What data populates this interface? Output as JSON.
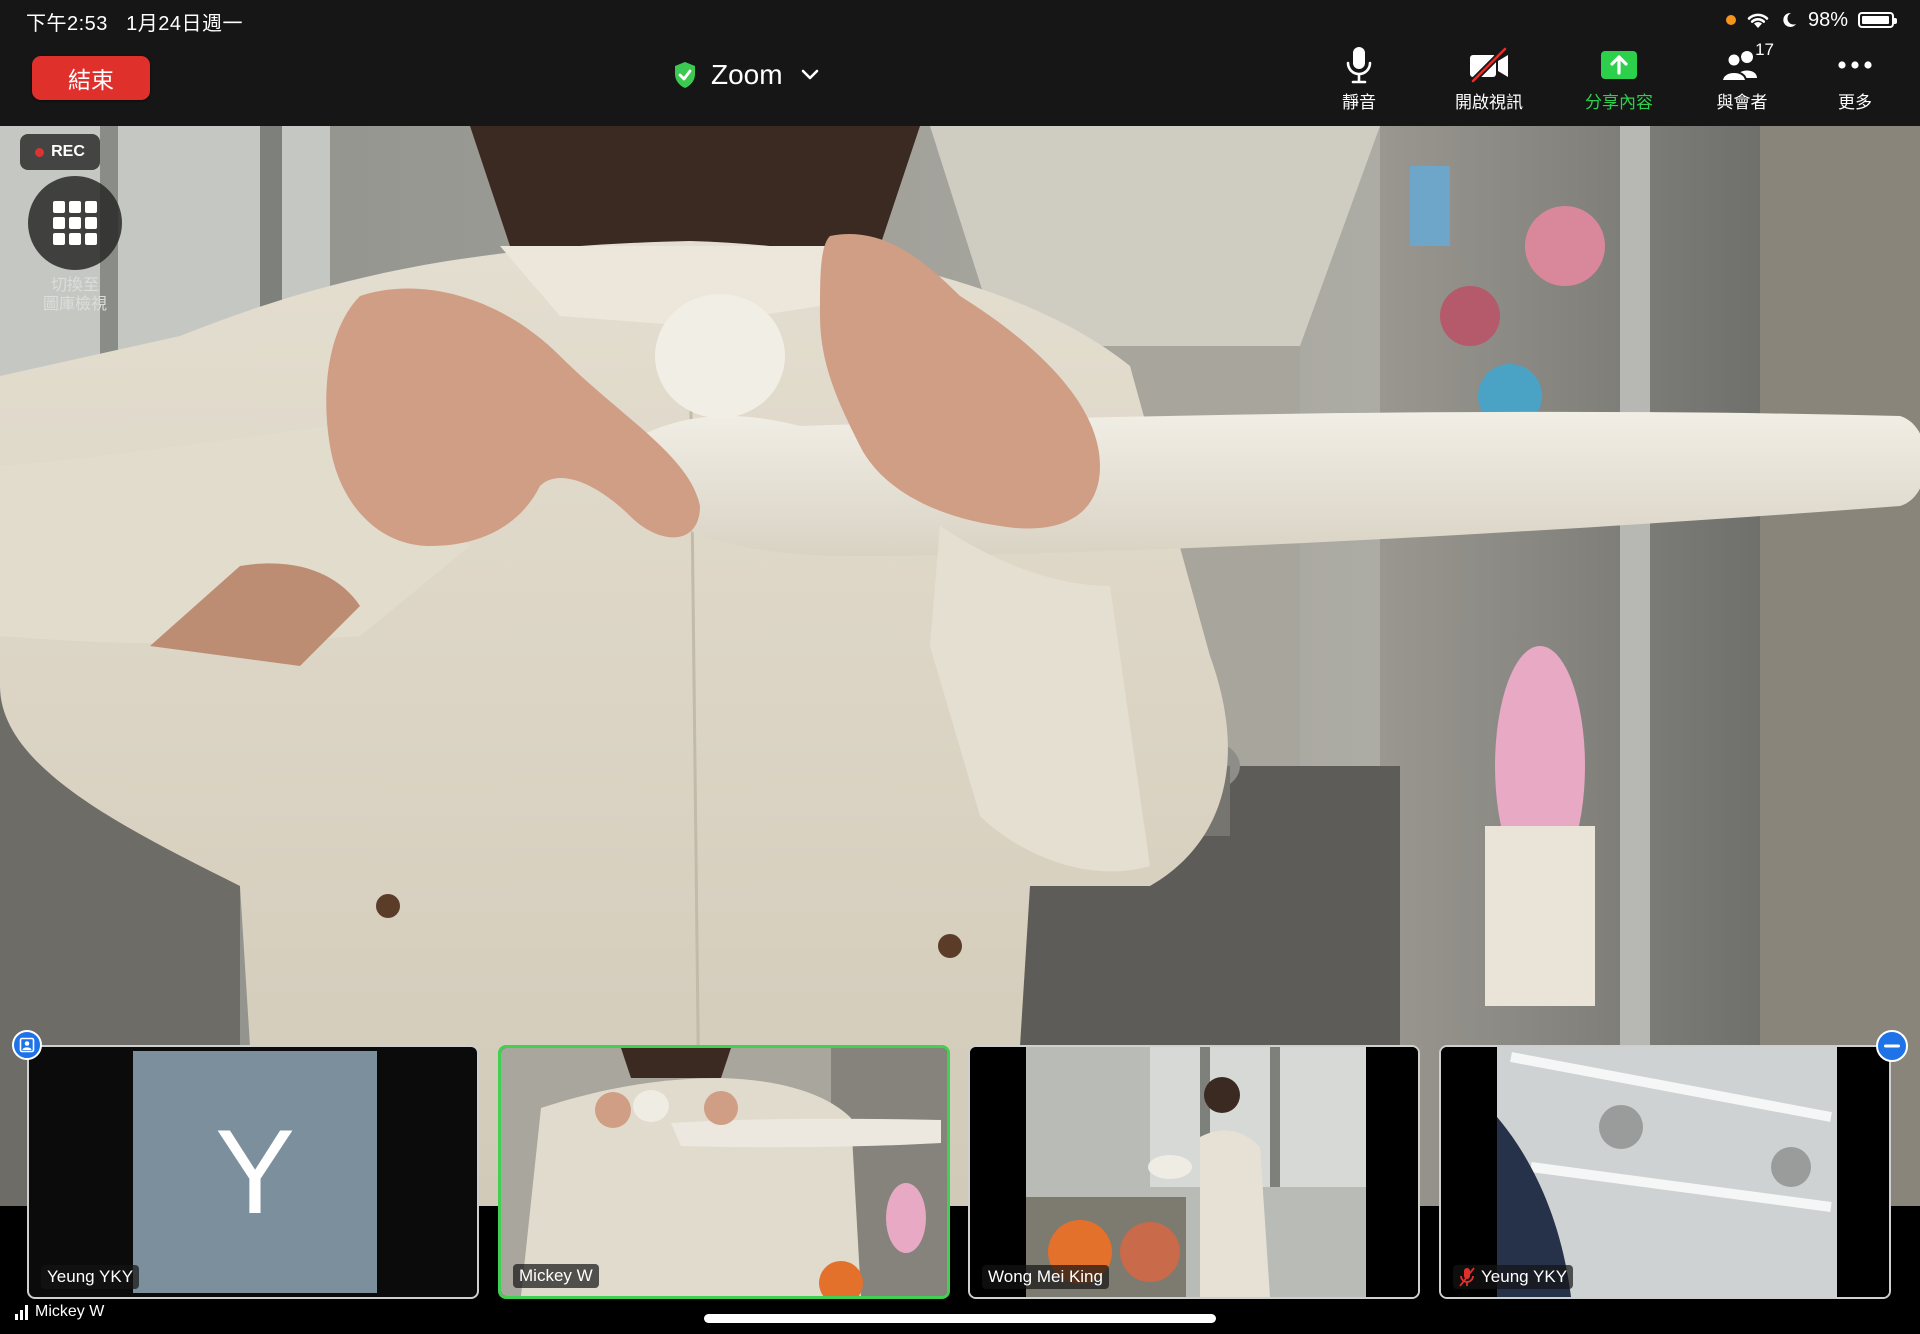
{
  "status_bar": {
    "time": "下午2:53",
    "date": "1月24日週一",
    "battery": "98%",
    "battery_level": 0.98
  },
  "toolbar": {
    "end_label": "結束",
    "meeting_title": "Zoom",
    "mute_label": "靜音",
    "video_label": "開啟視訊",
    "share_label": "分享內容",
    "participants_label": "與會者",
    "participants_count": "17",
    "more_label": "更多"
  },
  "overlay": {
    "rec_label": "REC",
    "gallery_label_line1": "切換至",
    "gallery_label_line2": "圖庫檢視"
  },
  "thumbnails": [
    {
      "name": "Yeung YKY",
      "avatar_letter": "Y",
      "type": "avatar"
    },
    {
      "name": "Mickey W",
      "type": "video",
      "active": true
    },
    {
      "name": "Wong Mei King",
      "type": "video"
    },
    {
      "name": "Yeung YKY",
      "type": "video",
      "muted": true
    }
  ],
  "active_speaker": "Mickey W",
  "colors": {
    "end_button": "#e0302c",
    "share_green": "#2dd04b",
    "active_border": "#3fd14f",
    "avatar_bg": "#7b8f9c",
    "toolbar_bg": "#161616"
  }
}
